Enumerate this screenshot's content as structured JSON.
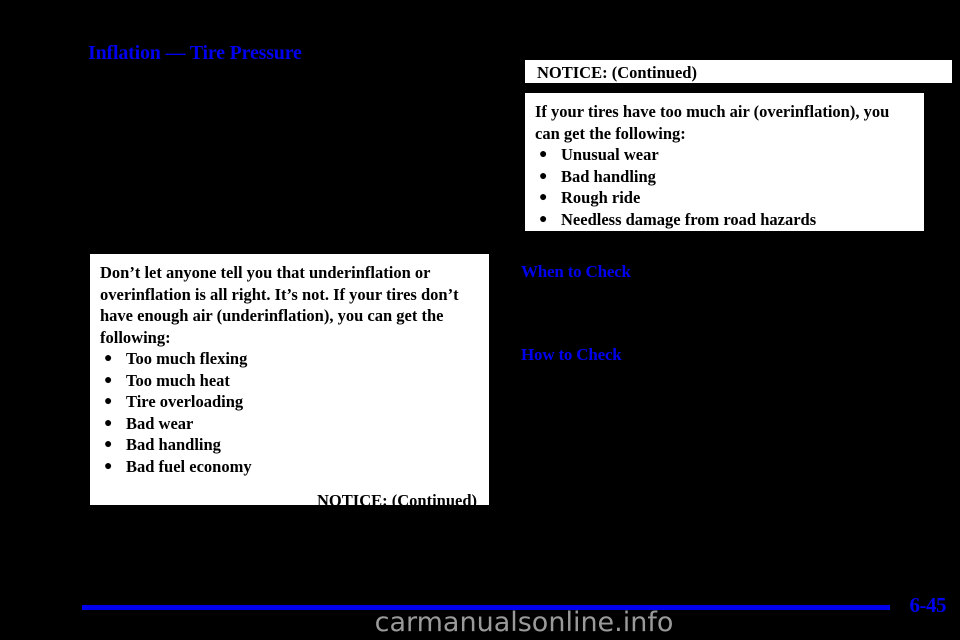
{
  "document": {
    "section_heading": "Inflation — Tire Pressure",
    "page_number": "6-45",
    "watermark": "carmanualsonline.info",
    "accent_color": "#0000ee",
    "background_color": "#000000",
    "box_background_color": "#ffffff"
  },
  "left_notice": {
    "paragraph": "Don’t let anyone tell you that underinflation or overinflation is all right. It’s not. If your tires don’t have enough air (underinflation), you can get the following:",
    "bullet_glyph": "●",
    "items": [
      "Too much flexing",
      "Too much heat",
      "Tire overloading",
      "Bad wear",
      "Bad handling",
      "Bad fuel economy"
    ],
    "continued_label": "NOTICE: (Continued)"
  },
  "right_notice": {
    "header": "NOTICE: (Continued)",
    "paragraph": "If your tires have too much air (overinflation), you can get the following:",
    "bullet_glyph": "●",
    "items": [
      "Unusual wear",
      "Bad handling",
      "Rough ride",
      "Needless damage from road hazards"
    ]
  },
  "subheadings": {
    "when_to_check": "When to Check",
    "how_to_check": "How to Check"
  }
}
